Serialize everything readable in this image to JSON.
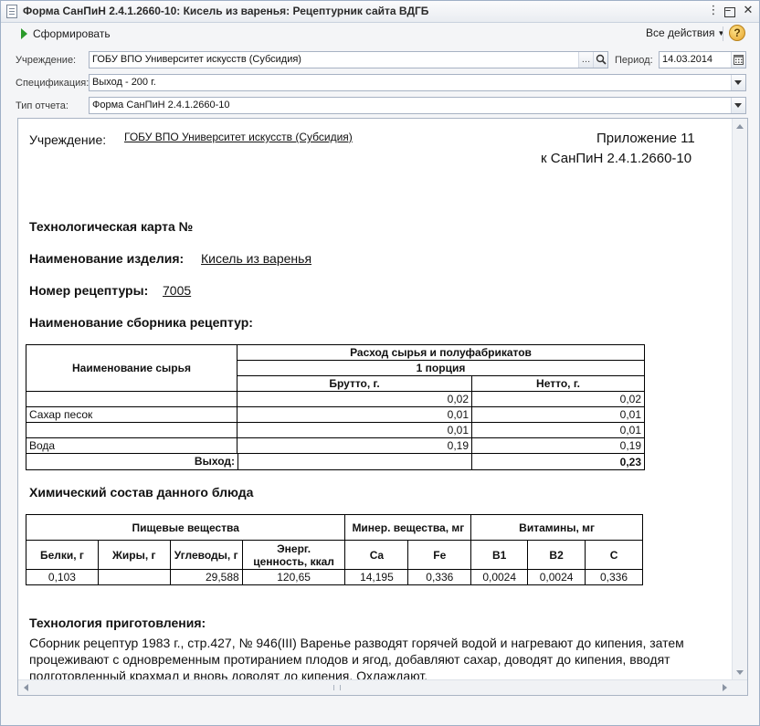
{
  "window": {
    "title": "Форма СанПиН 2.4.1.2660-10: Кисель из варенья: Рецептурник сайта ВДГБ"
  },
  "toolbar": {
    "generate_label": "Сформировать",
    "all_actions_label": "Все действия",
    "help_label": "?"
  },
  "form": {
    "institution_label": "Учреждение:",
    "institution_value": "ГОБУ ВПО Университет искусств (Субсидия)",
    "period_label": "Период:",
    "period_value": "14.03.2014",
    "spec_label": "Спецификация:",
    "spec_value": "Выход - 200 г.",
    "report_type_label": "Тип отчета:",
    "report_type_value": "Форма СанПиН 2.4.1.2660-10"
  },
  "report": {
    "institution_label": "Учреждение:",
    "institution_value": "ГОБУ ВПО Университет искусств (Субсидия)",
    "appendix_line1": "Приложение 11",
    "appendix_line2": "к СанПиН 2.4.1.2660-10",
    "tech_card_label": "Технологическая карта №",
    "product_name_label": "Наименование изделия:",
    "product_name_value": "Кисель из варенья",
    "recipe_number_label": "Номер рецептуры:",
    "recipe_number_value": "7005",
    "recipe_book_label": "Наименование сборника рецептур:",
    "ingredients_table": {
      "header_name": "Наименование сырья",
      "header_consumption": "Расход сырья и полуфабрикатов",
      "header_portion": "1 порция",
      "header_gross": "Брутто, г.",
      "header_net": "Нетто, г.",
      "rows": [
        {
          "name": "",
          "gross": "0,02",
          "net": "0,02"
        },
        {
          "name": "Сахар песок",
          "gross": "0,01",
          "net": "0,01"
        },
        {
          "name": "",
          "gross": "0,01",
          "net": "0,01"
        },
        {
          "name": "Вода",
          "gross": "0,19",
          "net": "0,19"
        }
      ],
      "yield_label": "Выход:",
      "yield_gross": "",
      "yield_net": "0,23"
    },
    "chem_title": "Химический состав данного блюда",
    "chem_table": {
      "group_nutrients": "Пищевые вещества",
      "group_minerals": "Минер. вещества, мг",
      "group_vitamins": "Витамины, мг",
      "col_protein": "Белки, г",
      "col_fat": "Жиры, г",
      "col_carbs": "Углеводы, г",
      "col_energy_1": "Энерг.",
      "col_energy_2": "ценность, ккал",
      "col_ca": "Ca",
      "col_fe": "Fe",
      "col_b1": "B1",
      "col_b2": "B2",
      "col_c": "C",
      "values": {
        "protein": "0,103",
        "fat": "",
        "carbs": "29,588",
        "energy": "120,65",
        "ca": "14,195",
        "fe": "0,336",
        "b1": "0,0024",
        "b2": "0,0024",
        "c": "0,336"
      }
    },
    "tech_title": "Технология приготовления:",
    "tech_text": "Сборник рецептур 1983 г., стр.427, № 946(III) Варенье разводят горячей водой и нагревают до кипения, затем процеживают с одновременным протиранием плодов и ягод, добавляют сахар, доводят до кипения, вводят подготовленный крахмал и вновь доводят до кипения. Охлаждают."
  },
  "icons": {
    "document": "document-icon",
    "run": "play-icon",
    "help": "help-icon",
    "select": "ellipsis-icon",
    "search": "search-icon",
    "calendar": "calendar-icon",
    "dropdown": "chevron-down-icon"
  }
}
